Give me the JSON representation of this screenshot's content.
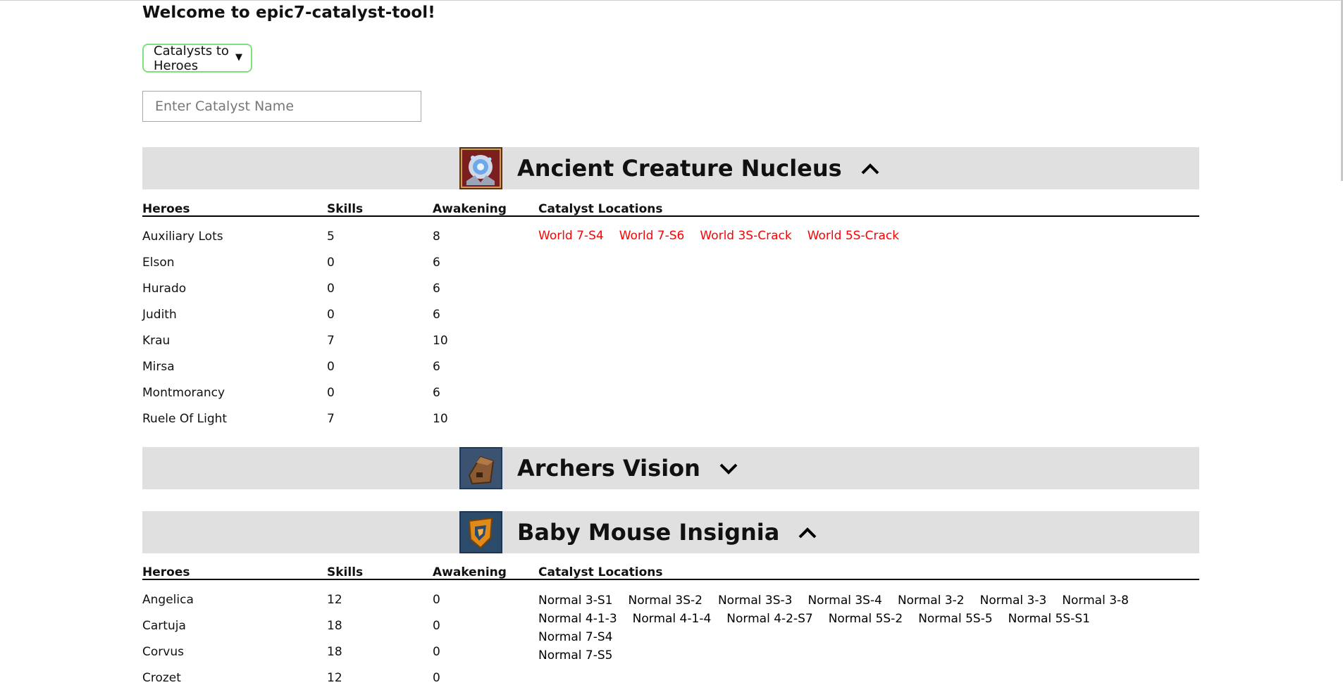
{
  "app": {
    "title": "Welcome to epic7-catalyst-tool!"
  },
  "mode_select": {
    "selected": "Catalysts to Heroes"
  },
  "search": {
    "placeholder": "Enter Catalyst Name",
    "value": ""
  },
  "table_headers": {
    "heroes": "Heroes",
    "skills": "Skills",
    "awakening": "Awakening",
    "locations": "Catalyst Locations"
  },
  "colors": {
    "header_bg": "#e0e0e0",
    "select_border": "#7ee07e",
    "world_location": "#ff0000",
    "normal_location": "#000000"
  },
  "catalysts": [
    {
      "name": "Ancient Creature Nucleus",
      "icon": "ancient-creature-nucleus-icon",
      "expanded": true,
      "chevron": "chevron-up-icon",
      "heroes": [
        {
          "name": "Auxiliary Lots",
          "skills": "5",
          "awakening": "8"
        },
        {
          "name": "Elson",
          "skills": "0",
          "awakening": "6"
        },
        {
          "name": "Hurado",
          "skills": "0",
          "awakening": "6"
        },
        {
          "name": "Judith",
          "skills": "0",
          "awakening": "6"
        },
        {
          "name": "Krau",
          "skills": "7",
          "awakening": "10"
        },
        {
          "name": "Mirsa",
          "skills": "0",
          "awakening": "6"
        },
        {
          "name": "Montmorancy",
          "skills": "0",
          "awakening": "6"
        },
        {
          "name": "Ruele Of Light",
          "skills": "7",
          "awakening": "10"
        }
      ],
      "locations": [
        "World 7-S4",
        "World 7-S6",
        "World 3S-Crack",
        "World 5S-Crack"
      ],
      "location_color": "#ff0000"
    },
    {
      "name": "Archers Vision",
      "icon": "archers-vision-icon",
      "expanded": false,
      "chevron": "chevron-down-icon",
      "heroes": [],
      "locations": []
    },
    {
      "name": "Baby Mouse Insignia",
      "icon": "baby-mouse-insignia-icon",
      "expanded": true,
      "chevron": "chevron-up-icon",
      "heroes": [
        {
          "name": "Angelica",
          "skills": "12",
          "awakening": "0"
        },
        {
          "name": "Cartuja",
          "skills": "18",
          "awakening": "0"
        },
        {
          "name": "Corvus",
          "skills": "18",
          "awakening": "0"
        },
        {
          "name": "Crozet",
          "skills": "12",
          "awakening": "0"
        }
      ],
      "locations": [
        "Normal 3-S1",
        "Normal 3S-2",
        "Normal 3S-3",
        "Normal 3S-4",
        "Normal 3-2",
        "Normal 3-3",
        "Normal 3-8",
        "Normal 4-1-3",
        "Normal 4-1-4",
        "Normal 4-2-S7",
        "Normal 5S-2",
        "Normal 5S-5",
        "Normal 5S-S1",
        "Normal 7-S4",
        "Normal 7-S5"
      ],
      "location_color": "#000000"
    }
  ]
}
